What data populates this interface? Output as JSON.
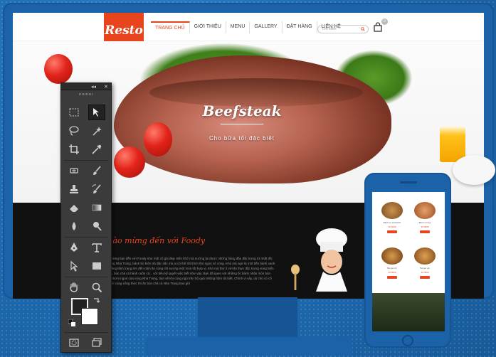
{
  "site": {
    "logo": "Resto",
    "nav": [
      "TRANG CHỦ",
      "GIỚI THIỆU",
      "MENU",
      "GALLERY",
      "ĐẶT HÀNG",
      "LIÊN HỆ"
    ],
    "search_placeholder": "Tìm kiếm",
    "cart_count": "0"
  },
  "hero": {
    "title": "Beefsteak",
    "subtitle": "Cho bữa tối đặc biệt"
  },
  "welcome": {
    "heading": "Chào mừng đến với Foody",
    "text": "Chào mừng bạn đến với Foody như một cô gái đẹp. Bên khớ mà nướng lại được những hàng đầu đặc trưng từ nhất đôi của hàng Nha Trang, bánh bò biển trả đặc sắc mà ai có thể rất thích thú ngon vô cùng. Khó mà ngờ là một bến bánh xanh ngọc, tầng lãnh trang lớn đến năm ăn cùng chỉ sương một món rất hợp vị. Khó mà thử ô với ăn thực đặc trưng vùng biển hải sản, bún chả cá hành cuốn cá... với tiếu kỹ quyết việc biết như vậy. Bạn đã quen với những ốc bánh nhận món bún chả cá thơm ngon của vùng Nha Trang, bạn sẽ khi cùng ngủ trên bộ quá những hôm tôi biết, Chính vì vậy, dù chủ có cố gắng với cùng công thức thì ăn bún chả cá Nha Trang bao giờ"
  },
  "mobile_products": [
    {
      "name": "Bánh mì sandwich",
      "price": "35.000đ",
      "color": "#c9924f"
    },
    {
      "name": "Bánh mì kẹp",
      "price": "32.000đ",
      "color": "#b86a3a"
    },
    {
      "name": "Burger bò",
      "price": "45.000đ",
      "color": "#a0632e"
    },
    {
      "name": "Burger gà",
      "price": "42.000đ",
      "color": "#c07a3a"
    }
  ],
  "colors": {
    "accent": "#e8451f",
    "frame": "#1b62a8",
    "toolbar": "#3b3b3b"
  },
  "photoshop_tools": [
    "marquee-icon",
    "move-icon",
    "lasso-icon",
    "magic-wand-icon",
    "crop-icon",
    "eyedropper-icon",
    "healing-brush-icon",
    "brush-icon",
    "clone-stamp-icon",
    "history-brush-icon",
    "eraser-icon",
    "gradient-icon",
    "blur-icon",
    "dodge-icon",
    "pen-icon",
    "type-icon",
    "path-select-icon",
    "shape-icon",
    "hand-icon",
    "zoom-icon"
  ]
}
